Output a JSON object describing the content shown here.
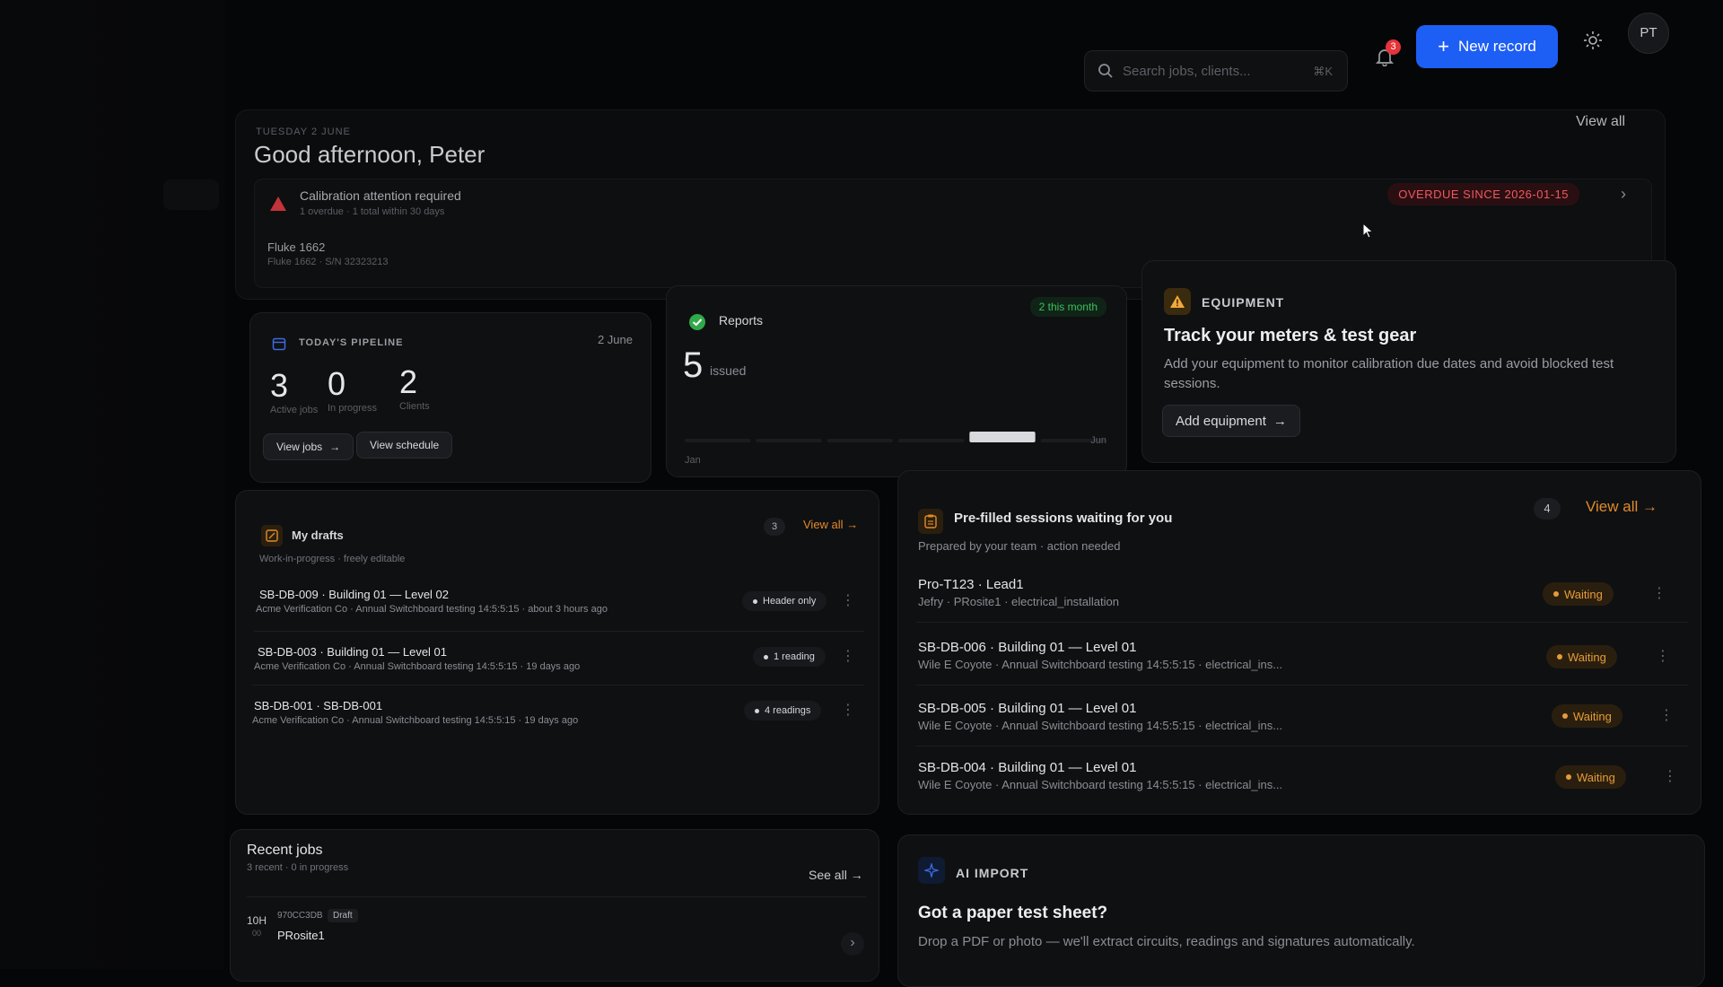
{
  "topbar": {
    "search_placeholder": "Search jobs, clients...",
    "search_shortcut": "⌘K",
    "notification_count": "3",
    "new_record_label": "New record",
    "avatar_initials": "PT",
    "accent_color": "#1d5ef5"
  },
  "greeting": {
    "date": "TUESDAY 2 JUNE",
    "title": "Good afternoon, Peter",
    "view_all": "View all"
  },
  "calibration": {
    "title": "Calibration attention required",
    "subtitle": "1 overdue · 1 total within 30 days",
    "badge": "OVERDUE SINCE 2026-01-15",
    "device_name": "Fluke 1662",
    "device_sub": "Fluke 1662 · S/N 32323213"
  },
  "pipeline": {
    "label": "TODAY'S PIPELINE",
    "date": "2 June",
    "stats": [
      {
        "value": "3",
        "label": "Active jobs"
      },
      {
        "value": "0",
        "label": "In progress"
      },
      {
        "value": "2",
        "label": "Clients"
      }
    ],
    "view_jobs": "View jobs",
    "view_schedule": "View schedule"
  },
  "reports": {
    "title": "Reports",
    "badge": "2 this month",
    "count": "5",
    "count_label": "issued",
    "x_start": "Jan",
    "x_end": "Jun",
    "monthly_values": [
      0,
      0,
      0,
      0,
      2,
      0
    ]
  },
  "equipment": {
    "label": "EQUIPMENT",
    "title": "Track your meters & test gear",
    "description": "Add your equipment to monitor calibration due dates and avoid blocked test sessions.",
    "button": "Add equipment"
  },
  "drafts": {
    "title": "My drafts",
    "subtitle": "Work-in-progress · freely editable",
    "count": "3",
    "view_all": "View all",
    "items": [
      {
        "title": "SB-DB-009 · Building 01 — Level 02",
        "sub": "Acme Verification Co · Annual Switchboard testing 14:5:5:15 · about 3 hours ago",
        "badge": "Header only"
      },
      {
        "title": "SB-DB-003 · Building 01 — Level 01",
        "sub": "Acme Verification Co · Annual Switchboard testing 14:5:5:15 · 19 days ago",
        "badge": "1 reading"
      },
      {
        "title": "SB-DB-001 · SB-DB-001",
        "sub": "Acme Verification Co · Annual Switchboard testing 14:5:5:15 · 19 days ago",
        "badge": "4 readings"
      }
    ]
  },
  "sessions": {
    "title": "Pre-filled sessions waiting for you",
    "subtitle": "Prepared by your team · action needed",
    "count": "4",
    "view_all": "View all",
    "items": [
      {
        "title": "Pro-T123 · Lead1",
        "sub": "Jefry · PRosite1 · electrical_installation",
        "status": "Waiting"
      },
      {
        "title": "SB-DB-006 · Building 01 — Level 01",
        "sub": "Wile E Coyote · Annual Switchboard testing 14:5:5:15 · electrical_ins...",
        "status": "Waiting"
      },
      {
        "title": "SB-DB-005 · Building 01 — Level 01",
        "sub": "Wile E Coyote · Annual Switchboard testing 14:5:5:15 · electrical_ins...",
        "status": "Waiting"
      },
      {
        "title": "SB-DB-004 · Building 01 — Level 01",
        "sub": "Wile E Coyote · Annual Switchboard testing 14:5:5:15 · electrical_ins...",
        "status": "Waiting"
      }
    ]
  },
  "recent_jobs": {
    "title": "Recent jobs",
    "subtitle": "3 recent · 0 in progress",
    "see_all": "See all",
    "items": [
      {
        "time": "10H",
        "time_sub": "00",
        "code": "970CC3DB",
        "status": "Draft",
        "name": "PRosite1"
      }
    ]
  },
  "ai_import": {
    "label": "AI IMPORT",
    "title": "Got a paper test sheet?",
    "description": "Drop a PDF or photo — we'll extract circuits, readings and signatures automatically."
  }
}
